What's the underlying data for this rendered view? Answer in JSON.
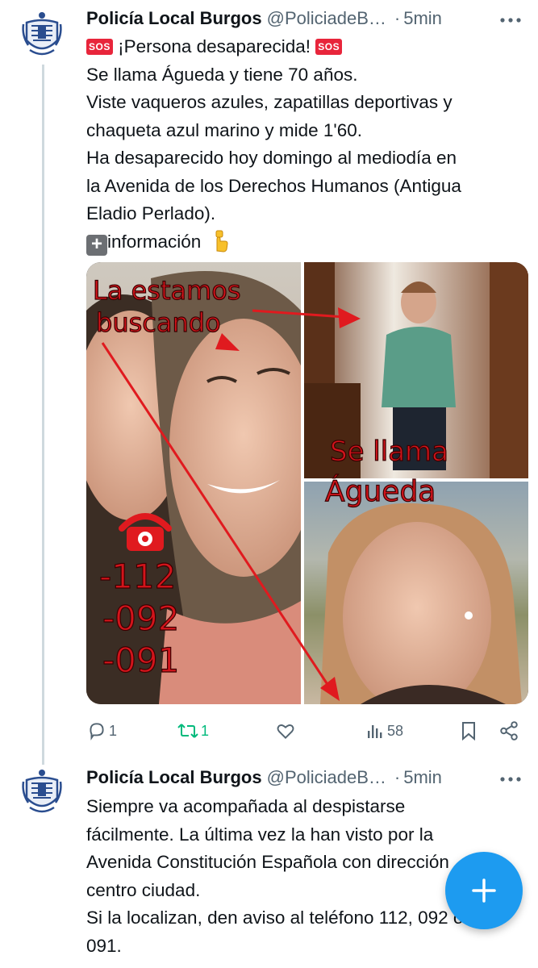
{
  "tweets": [
    {
      "author": {
        "name": "Policía Local Burgos",
        "handle": "@PoliciadeB…",
        "avatar_icon": "police-badge-icon"
      },
      "time": "5min",
      "separator": "·",
      "more_icon": "more-icon",
      "lines": {
        "title": "¡Persona desaparecida!",
        "l1": "Se llama Águeda y tiene 70 años.",
        "l2": "Viste vaqueros azules, zapatillas deportivas y",
        "l3": "chaqueta azul marino y mide 1'60.",
        "l4": "Ha desaparecido hoy domingo al mediodía en",
        "l5": "la Avenida de los Derechos Humanos (Antigua",
        "l6": "Eladio Perlado).",
        "l7": "información"
      },
      "sos_badge": "SOS",
      "image_overlay": {
        "text1a": "La estamos",
        "text1b": "buscando",
        "text2a": "Se llama",
        "text2b": "Águeda",
        "phone1": "-112",
        "phone2": "-092",
        "phone3": "-091"
      },
      "actions": {
        "replies": "1",
        "retweets": "1",
        "likes": "",
        "views": "58"
      }
    },
    {
      "author": {
        "name": "Policía Local Burgos",
        "handle": "@PoliciadeB…",
        "avatar_icon": "police-badge-icon"
      },
      "time": "5min",
      "separator": "·",
      "lines": {
        "l1": "Siempre va acompañada al despistarse",
        "l2": "fácilmente. La última vez la han visto por la",
        "l3": "Avenida Constitución Española con dirección",
        "l4": "centro ciudad.",
        "l5": "Si la localizan, den aviso al teléfono 112, 092 o",
        "l6": "091."
      }
    }
  ],
  "compose_button": {
    "icon": "plus-icon"
  },
  "colors": {
    "accent": "#1d9bf0",
    "retweet": "#00ba7c",
    "muted": "#536471",
    "overlay_red": "#d3141b"
  }
}
